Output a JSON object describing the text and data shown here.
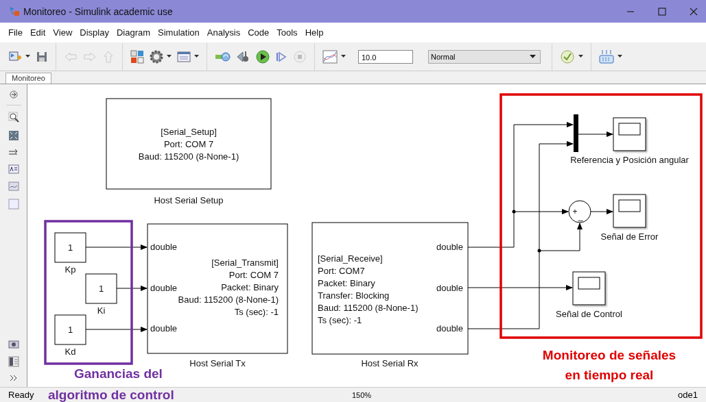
{
  "window": {
    "title": "Monitoreo - Simulink academic use"
  },
  "menu": [
    "File",
    "Edit",
    "View",
    "Display",
    "Diagram",
    "Simulation",
    "Analysis",
    "Code",
    "Tools",
    "Help"
  ],
  "toolbar": {
    "stop_time": "10.0",
    "simulation_mode": "Normal"
  },
  "tabs": [
    {
      "label": "Monitoreo",
      "selected": true
    }
  ],
  "diagram": {
    "setup_block": {
      "parameters": [
        "[Serial_Setup]",
        "Port: COM 7",
        "Baud: 115200 (8-None-1)"
      ],
      "name": "Host Serial Setup"
    },
    "gains": [
      {
        "value": "1",
        "name": "Kp"
      },
      {
        "value": "1",
        "name": "Ki"
      },
      {
        "value": "1",
        "name": "Kd"
      }
    ],
    "transmit_block": {
      "inputs": [
        "double",
        "double",
        "double"
      ],
      "parameters": [
        "[Serial_Transmit]",
        "Port: COM 7",
        "Packet: Binary",
        "Baud: 115200 (8-None-1)",
        "Ts (sec): -1"
      ],
      "name": "Host Serial Tx"
    },
    "receive_block": {
      "outputs": [
        "double",
        "double",
        "double"
      ],
      "parameters": [
        "[Serial_Receive]",
        "Port: COM7",
        "Packet: Binary",
        "Transfer: Blocking",
        "Baud: 115200 (8-None-1)",
        "Ts (sec): -1"
      ],
      "name": "Host Serial Rx"
    },
    "sum_block": {
      "signs": [
        "+",
        "_"
      ]
    },
    "scopes": [
      {
        "name": "Referencia y Posición angular"
      },
      {
        "name": "Señal de Error"
      },
      {
        "name": "Señal de Control"
      }
    ],
    "annotations": [
      {
        "lines": [
          "Ganancias del",
          "algoritmo de control"
        ],
        "color": "#7030a0"
      },
      {
        "lines": [
          "Monitoreo de señales",
          "en tiempo real"
        ],
        "color": "#e00000"
      }
    ]
  },
  "status_bar": {
    "state": "Ready",
    "zoom": "150%",
    "solver": "ode1"
  }
}
